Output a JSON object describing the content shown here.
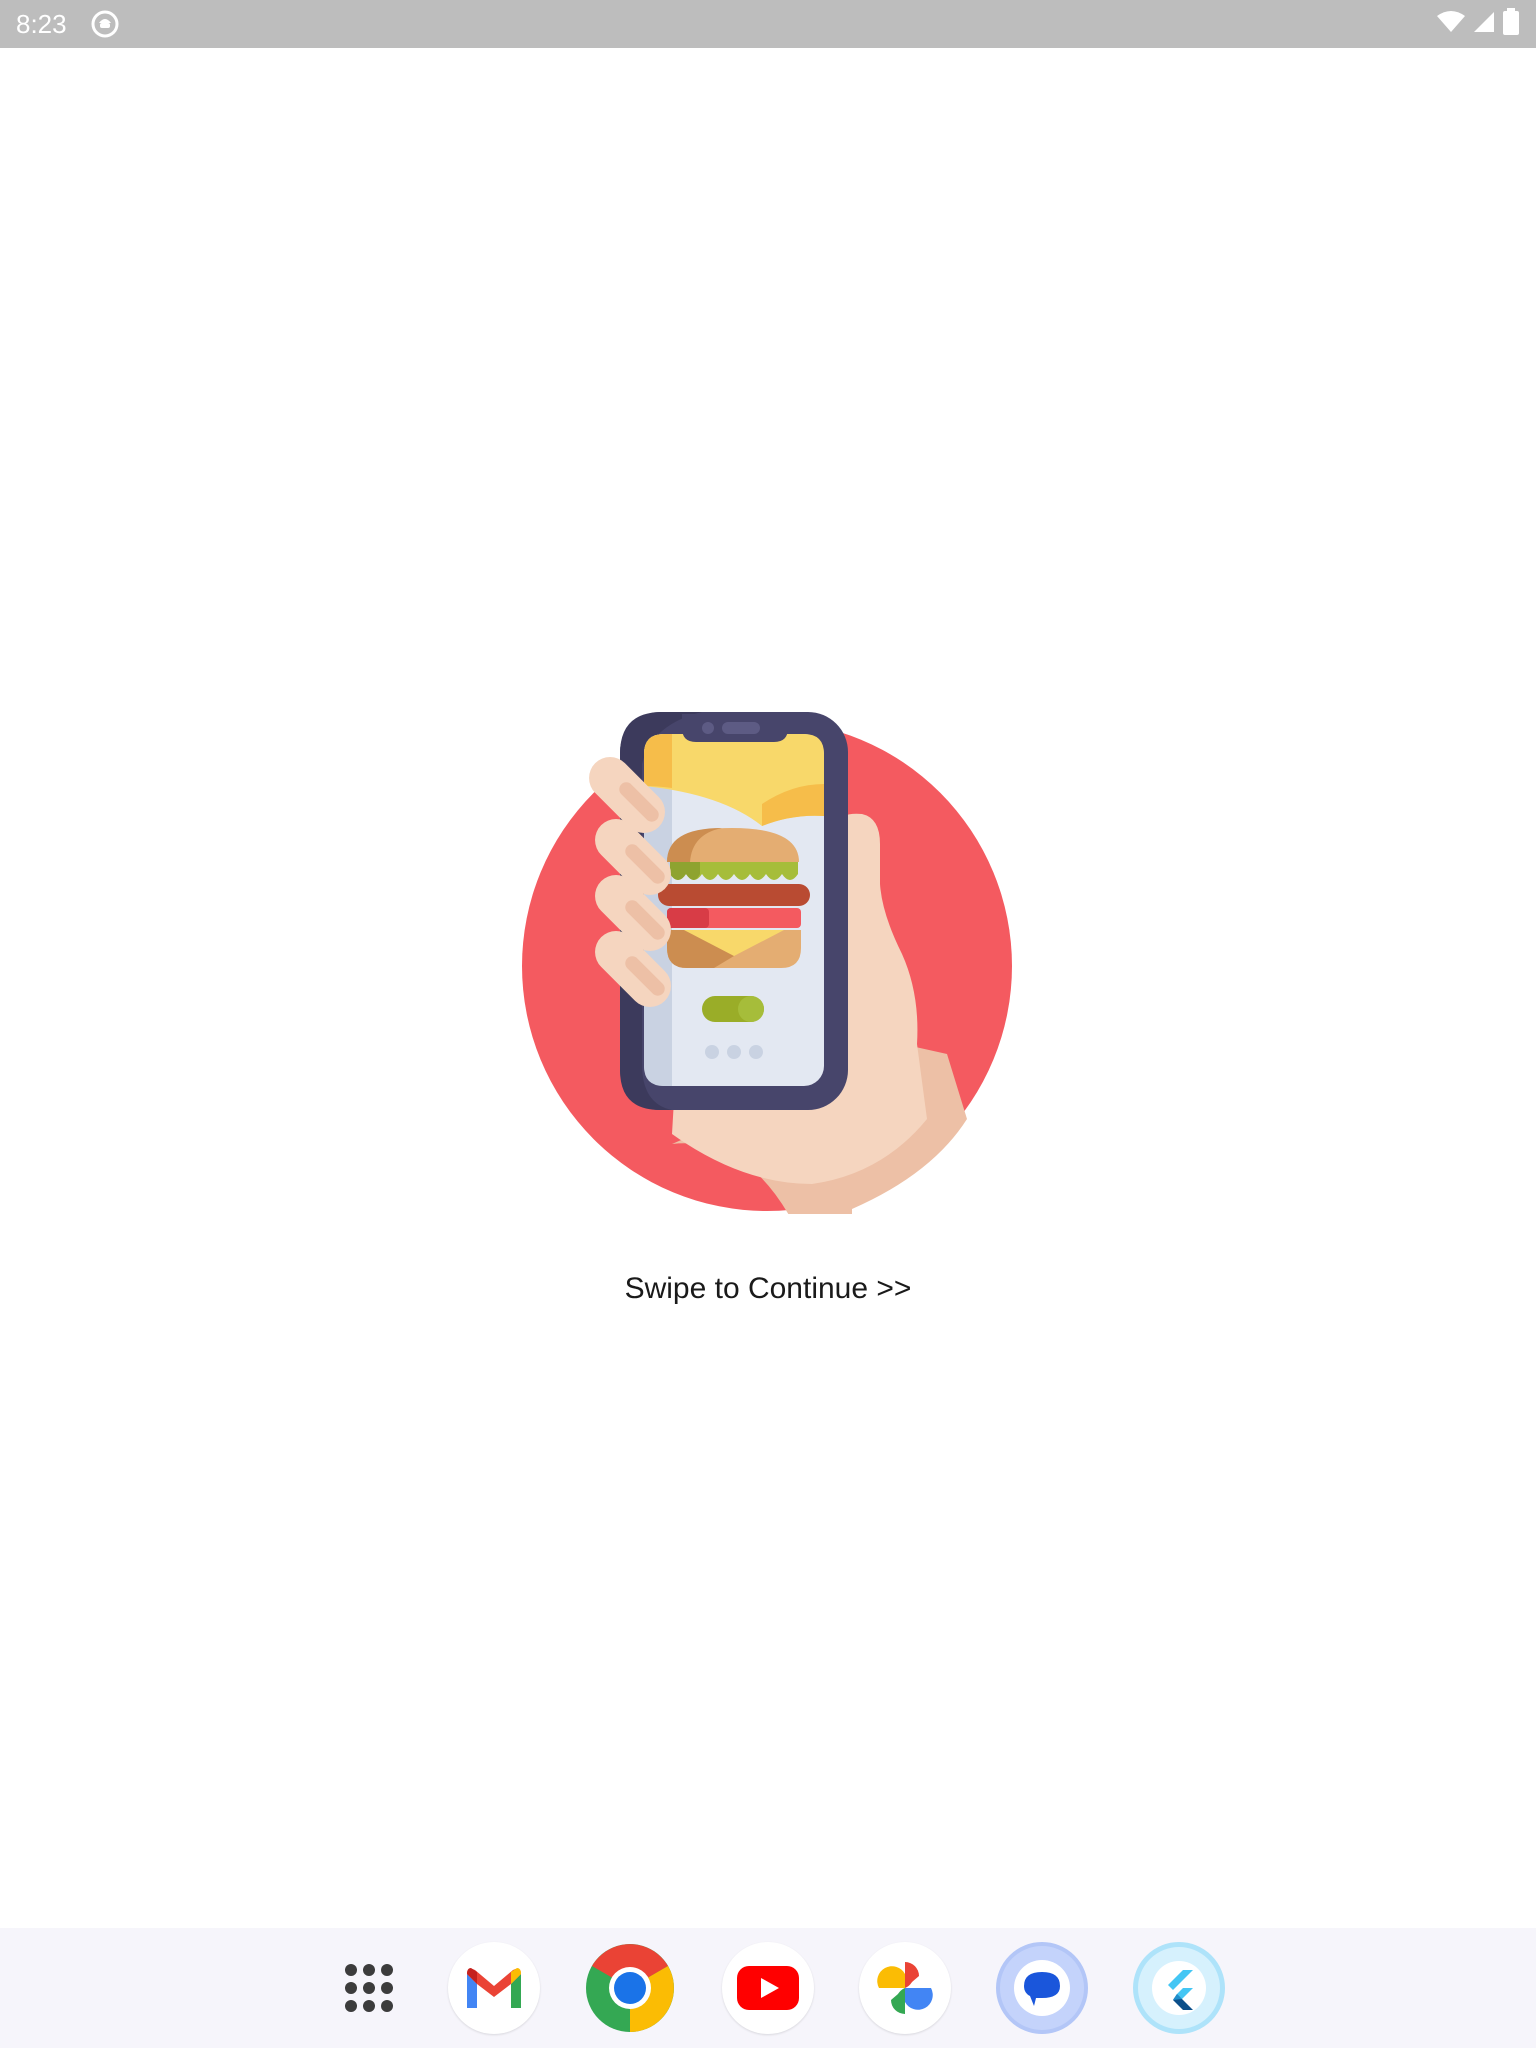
{
  "status_bar": {
    "time": "8:23",
    "app_icon": "launcher-face-icon",
    "wifi_icon": "wifi-icon",
    "signal_icon": "cell-signal-icon",
    "battery_icon": "battery-icon"
  },
  "onboarding": {
    "illustration": "hand-holding-phone-burger-icon",
    "swipe_label": "Swipe to Continue >>"
  },
  "dock": {
    "apps": [
      {
        "name": "All apps",
        "icon": "app-drawer-icon"
      },
      {
        "name": "Gmail",
        "icon": "gmail-icon"
      },
      {
        "name": "Chrome",
        "icon": "chrome-icon"
      },
      {
        "name": "YouTube",
        "icon": "youtube-icon"
      },
      {
        "name": "Photos",
        "icon": "photos-icon"
      },
      {
        "name": "Messages",
        "icon": "messages-icon"
      },
      {
        "name": "Flutter",
        "icon": "flutter-icon"
      }
    ]
  },
  "colors": {
    "status_bar": "#bdbdbd",
    "circle": "#f45a60",
    "phone_frame": "#47456b",
    "skin": "#f5d5bf",
    "dock_bg": "#f6f5fb"
  }
}
